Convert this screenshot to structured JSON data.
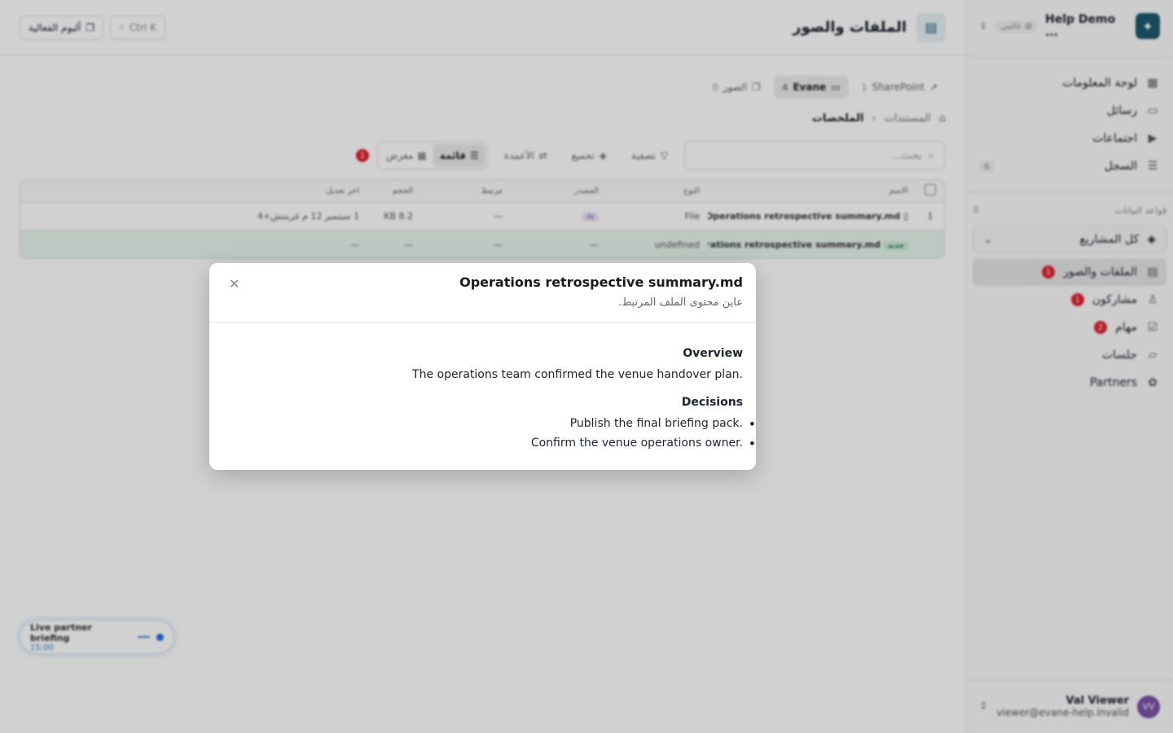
{
  "sidebar": {
    "workspace_name": "Help Demo ...",
    "workspace_scope": "عالمي",
    "nav": [
      {
        "label": "لوحة المعلومات",
        "count": ""
      },
      {
        "label": "رسائل",
        "count": ""
      },
      {
        "label": "اجتماعات",
        "count": ""
      },
      {
        "label": "السجل",
        "count": "6"
      }
    ],
    "databases_label": "قواعد البيانات",
    "project_select": "كل المشاريع",
    "db_items": [
      {
        "label": "الملفات والصور",
        "badge": "1"
      },
      {
        "label": "مشاركون",
        "badge": "1"
      },
      {
        "label": "مهام",
        "badge": "2"
      },
      {
        "label": "جلسات",
        "badge": ""
      },
      {
        "label": "Partners",
        "badge": ""
      }
    ],
    "user": {
      "initials": "VV",
      "name": "Val Viewer",
      "email": "viewer@evane-help.invalid"
    }
  },
  "topbar": {
    "title": "الملفات والصور",
    "album_button": "ألبوم الفعالية",
    "search_shortcut": "Ctrl K"
  },
  "tabs": [
    {
      "label": "SharePoint",
      "count": "1"
    },
    {
      "label": "Evane",
      "count": "4"
    },
    {
      "label": "الصور",
      "count": "0"
    }
  ],
  "breadcrumb": {
    "root": "المستندات",
    "current": "الملخصات"
  },
  "toolbar": {
    "search_placeholder": "بحث...",
    "filter": "تصفية",
    "group": "تجميع",
    "columns": "الأعمدة",
    "list_view": "قائمة",
    "gallery_view": "معرض",
    "alert_count": "1"
  },
  "table": {
    "headers": [
      "الاسم",
      "النوع",
      "المصدر",
      "مرتبط",
      "الحجم",
      "آخر تعديل"
    ],
    "rows": [
      {
        "index": "1",
        "name": "Operations retrospective summary.md",
        "type": "File",
        "source": "AI",
        "linked": "—",
        "size": "8.2 KB",
        "modified": "1 سبتمبر 12 م غرينتش+4"
      },
      {
        "index": "",
        "chip": "جديد",
        "name": "Operations retrospective summary.md",
        "type": "undefined",
        "source": "—",
        "linked": "—",
        "size": "—",
        "modified": "—"
      }
    ]
  },
  "live_pill": {
    "title": "Live partner briefing",
    "time": "15:00"
  },
  "modal": {
    "title": "Operations retrospective summary.md",
    "subtitle": "عاين محتوى الملف المرتبط.",
    "overview_heading": "Overview",
    "overview_text": "The operations team confirmed the venue handover plan.",
    "decisions_heading": "Decisions",
    "decisions": [
      "Publish the final briefing pack.",
      "Confirm the venue operations owner."
    ]
  },
  "colors": {
    "accent": "#1e5a6e",
    "badge": "#e0242f",
    "new_row": "#e6f4ec"
  }
}
